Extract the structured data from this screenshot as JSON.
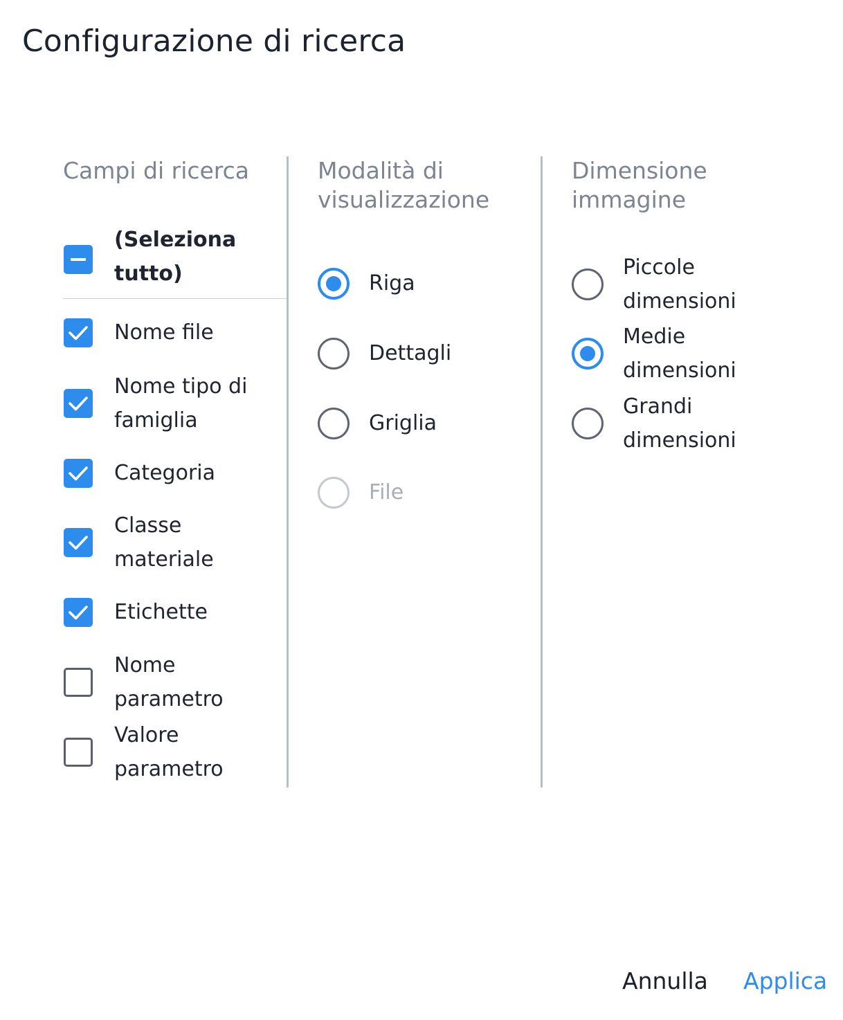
{
  "dialog": {
    "title": "Configurazione di ricerca"
  },
  "fields": {
    "title": "Campi di ricerca",
    "select_all": {
      "label": "(Seleziona tutto)",
      "state": "indeterminate"
    },
    "items": [
      {
        "label": "Nome file",
        "checked": true
      },
      {
        "label": "Nome tipo di famiglia",
        "checked": true
      },
      {
        "label": "Categoria",
        "checked": true
      },
      {
        "label": "Classe materiale",
        "checked": true
      },
      {
        "label": "Etichette",
        "checked": true
      },
      {
        "label": "Nome parametro",
        "checked": false
      },
      {
        "label": "Valore parametro",
        "checked": false
      }
    ]
  },
  "view_mode": {
    "title": "Modalità di visualizzazione",
    "options": [
      {
        "label": "Riga",
        "selected": true,
        "disabled": false
      },
      {
        "label": "Dettagli",
        "selected": false,
        "disabled": false
      },
      {
        "label": "Griglia",
        "selected": false,
        "disabled": false
      },
      {
        "label": "File",
        "selected": false,
        "disabled": true
      }
    ]
  },
  "image_size": {
    "title": "Dimensione immagine",
    "options": [
      {
        "label": "Piccole dimensioni",
        "selected": false
      },
      {
        "label": "Medie dimensioni",
        "selected": true
      },
      {
        "label": "Grandi dimensioni",
        "selected": false
      }
    ]
  },
  "footer": {
    "cancel_label": "Annulla",
    "apply_label": "Applica"
  },
  "colors": {
    "accent": "#2d8cec",
    "divider": "#b8bec7",
    "muted_text": "#7c8491"
  }
}
